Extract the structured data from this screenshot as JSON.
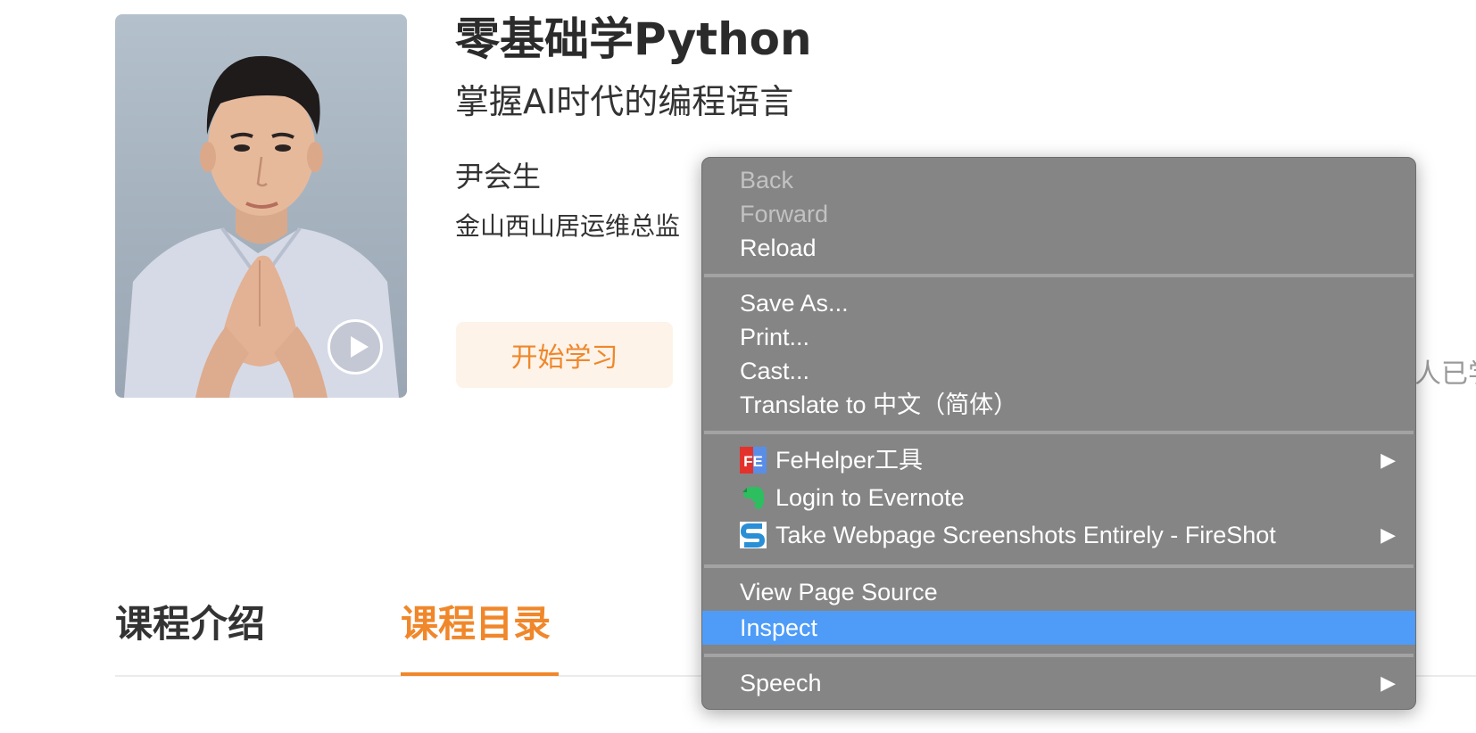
{
  "course": {
    "title": "零基础学Python",
    "subtitle": "掌握AI时代的编程语言",
    "teacher_name": "尹会生",
    "teacher_title": "金山西山居运维总监",
    "start_button": "开始学习",
    "learners_partial": "人已学"
  },
  "tabs": [
    {
      "label": "课程介绍",
      "active": false
    },
    {
      "label": "课程目录",
      "active": true
    }
  ],
  "context_menu": {
    "back": "Back",
    "forward": "Forward",
    "reload": "Reload",
    "save_as": "Save As...",
    "print": "Print...",
    "cast": "Cast...",
    "translate": "Translate to 中文（简体）",
    "extensions": [
      {
        "label": "FeHelper工具",
        "icon": "fehelper-icon",
        "submenu": true
      },
      {
        "label": "Login to Evernote",
        "icon": "evernote-icon",
        "submenu": false
      },
      {
        "label": "Take Webpage Screenshots Entirely - FireShot",
        "icon": "fireshot-icon",
        "submenu": true
      }
    ],
    "view_source": "View Page Source",
    "inspect": "Inspect",
    "speech": "Speech",
    "fe_icon_text": "FE"
  },
  "colors": {
    "accent": "#f0872a",
    "menu_bg": "#858585",
    "menu_highlight": "#4e9cf8"
  }
}
